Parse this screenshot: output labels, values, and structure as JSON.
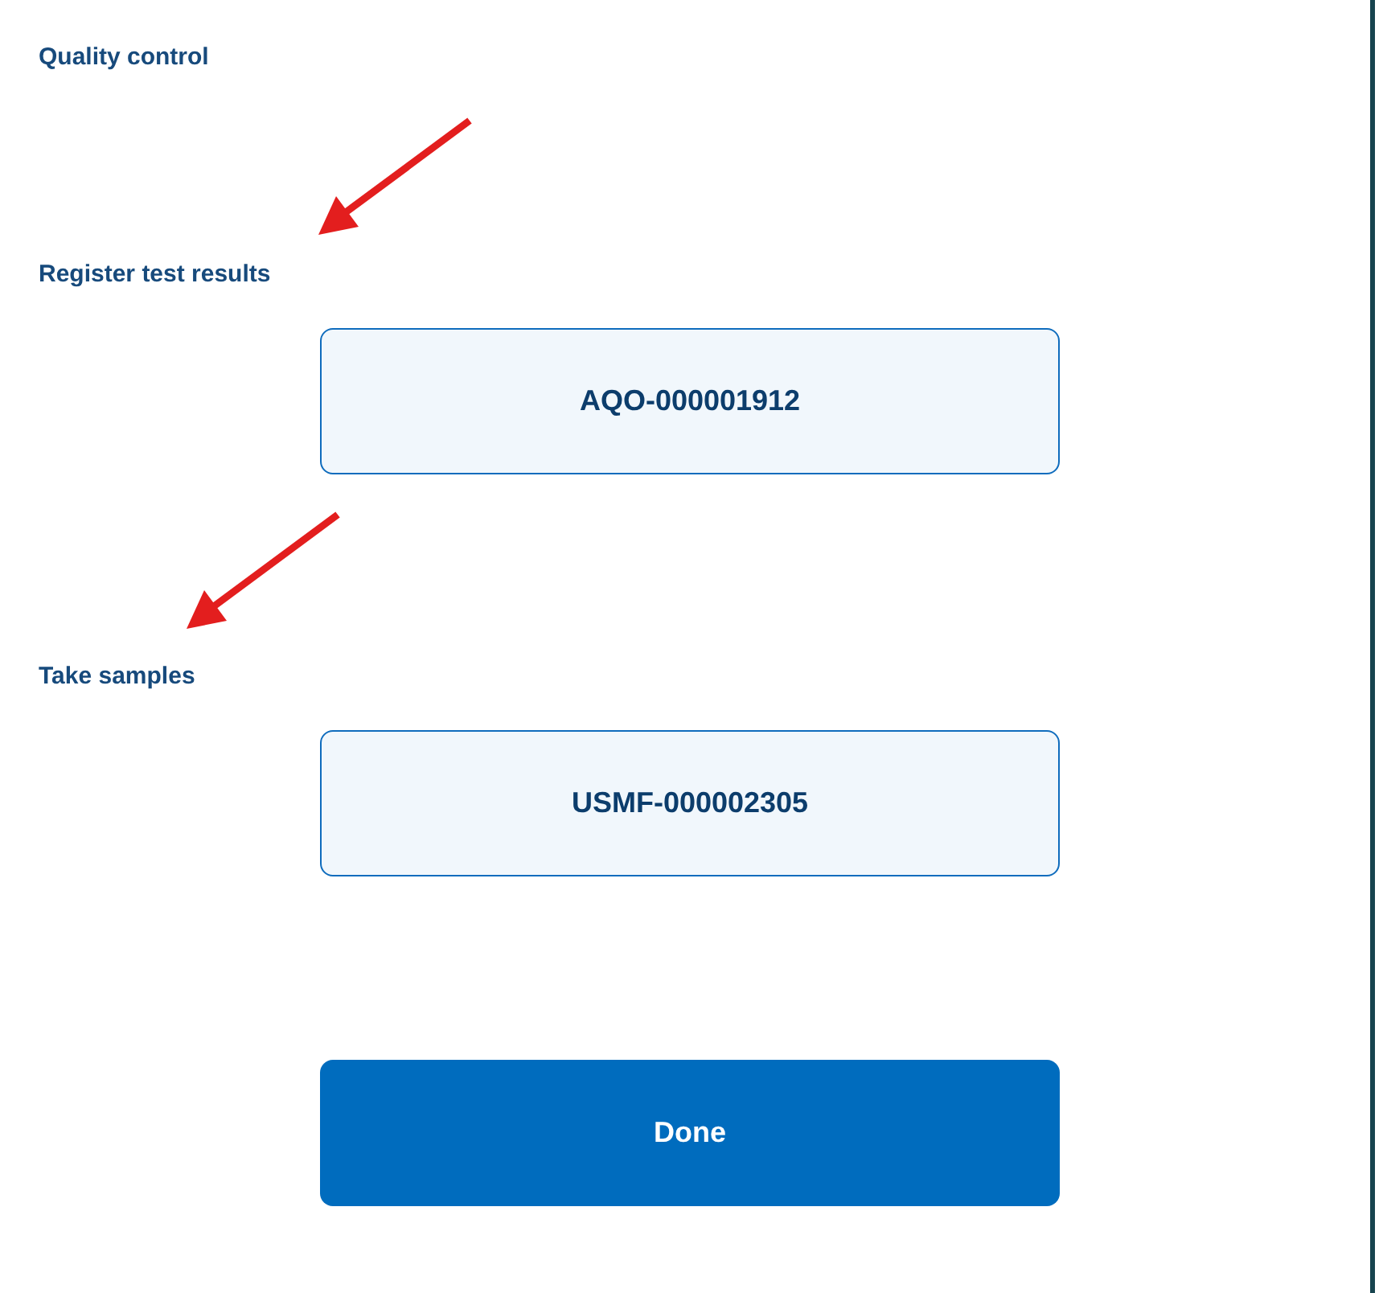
{
  "sections": [
    {
      "heading": "Quality control",
      "annotation_arrow": false
    },
    {
      "heading": "Register test results",
      "annotation_arrow": true,
      "order_button": "AQO-000001912"
    },
    {
      "heading": "Take samples",
      "annotation_arrow": true,
      "order_button": "USMF-000002305"
    }
  ],
  "done_button": "Done"
}
